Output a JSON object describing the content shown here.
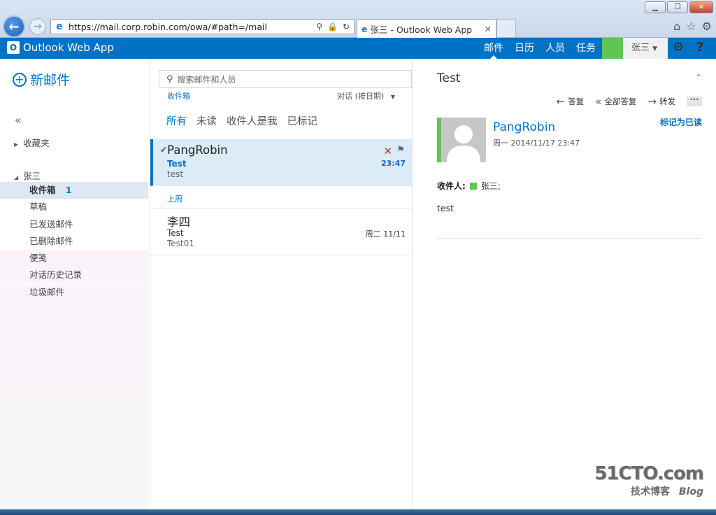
{
  "browser": {
    "url": "https://mail.corp.robin.com/owa/#path=/mail",
    "tab_title": "张三 - Outlook Web App",
    "window_buttons": [
      "minimize-icon",
      "restore-icon",
      "close-icon"
    ]
  },
  "owa": {
    "app_name": "Outlook Web App",
    "nav": [
      "邮件",
      "日历",
      "人员",
      "任务"
    ],
    "user_name": "张三",
    "settings_icon": "gear-icon",
    "help_label": "?"
  },
  "folders": {
    "new_mail": "新邮件",
    "collapse": "«",
    "favorites": "收藏夹",
    "account": "张三",
    "items": [
      {
        "label": "收件箱",
        "count": "1"
      },
      {
        "label": "草稿"
      },
      {
        "label": "已发送邮件"
      },
      {
        "label": "已删除邮件"
      },
      {
        "label": "便笺"
      },
      {
        "label": "对话历史记录"
      },
      {
        "label": "垃圾邮件"
      }
    ]
  },
  "list": {
    "search_placeholder": "搜索邮件和人员",
    "folder_crumb": "收件箱",
    "sort": "对话 (按日期)",
    "filters": [
      "所有",
      "未读",
      "收件人是我",
      "已标记"
    ],
    "group_last_week": "上周",
    "messages": [
      {
        "from": "PangRobin",
        "subject": "Test",
        "preview": "test",
        "time": "23:47"
      },
      {
        "from": "李四",
        "subject": "Test",
        "preview": "Test01",
        "time": "周二 11/11"
      }
    ]
  },
  "reading": {
    "subject": "Test",
    "reply": "答复",
    "reply_all": "全部答复",
    "forward": "转发",
    "more": "···",
    "sender": "PangRobin",
    "sent": "周一 2014/11/17 23:47",
    "mark_read": "标记为已读",
    "to_label": "收件人:",
    "to_name": "张三;",
    "body": "test"
  },
  "watermark": {
    "line1": "51CTO.com",
    "line2": "技术博客",
    "line3": "Blog"
  },
  "colors": {
    "accent": "#0072c6",
    "presence": "#5ec653",
    "selected_row": "#dcebf8"
  }
}
